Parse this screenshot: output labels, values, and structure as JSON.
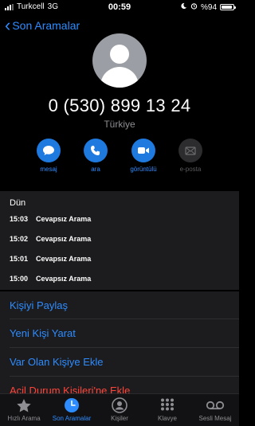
{
  "status_bar": {
    "carrier": "Turkcell",
    "network": "3G",
    "time": "00:59",
    "battery_label": "%94",
    "battery_level": 0.94
  },
  "nav": {
    "back_label": "Son Aramalar"
  },
  "contact": {
    "phone_number": "0 (530) 899 13 24",
    "country": "Türkiye"
  },
  "actions": [
    {
      "label": "mesaj",
      "icon": "message-icon"
    },
    {
      "label": "ara",
      "icon": "phone-icon"
    },
    {
      "label": "görüntülü",
      "icon": "video-icon"
    },
    {
      "label": "e-posta",
      "icon": "mail-icon"
    }
  ],
  "calls": {
    "date": "Dün",
    "items": [
      {
        "time": "15:03",
        "type": "Cevapsız Arama"
      },
      {
        "time": "15:02",
        "type": "Cevapsız Arama"
      },
      {
        "time": "15:01",
        "type": "Cevapsız Arama"
      },
      {
        "time": "15:00",
        "type": "Cevapsız Arama"
      }
    ]
  },
  "menu": [
    {
      "label": "Kişiyi Paylaş"
    },
    {
      "label": "Yeni Kişi Yarat"
    },
    {
      "label": "Var Olan Kişiye Ekle"
    },
    {
      "label": "Acil Durum Kişileri'ne Ekle"
    }
  ],
  "tabs": [
    {
      "label": "Hızlı Arama",
      "icon": "star-icon"
    },
    {
      "label": "Son Aramalar",
      "icon": "clock-icon"
    },
    {
      "label": "Kişiler",
      "icon": "contacts-icon"
    },
    {
      "label": "Klavye",
      "icon": "keypad-icon"
    },
    {
      "label": "Sesli Mesaj",
      "icon": "voicemail-icon"
    }
  ],
  "colors": {
    "accent": "#2d8cff",
    "destructive": "#ff453a",
    "avatar": "#9b9ea4"
  }
}
